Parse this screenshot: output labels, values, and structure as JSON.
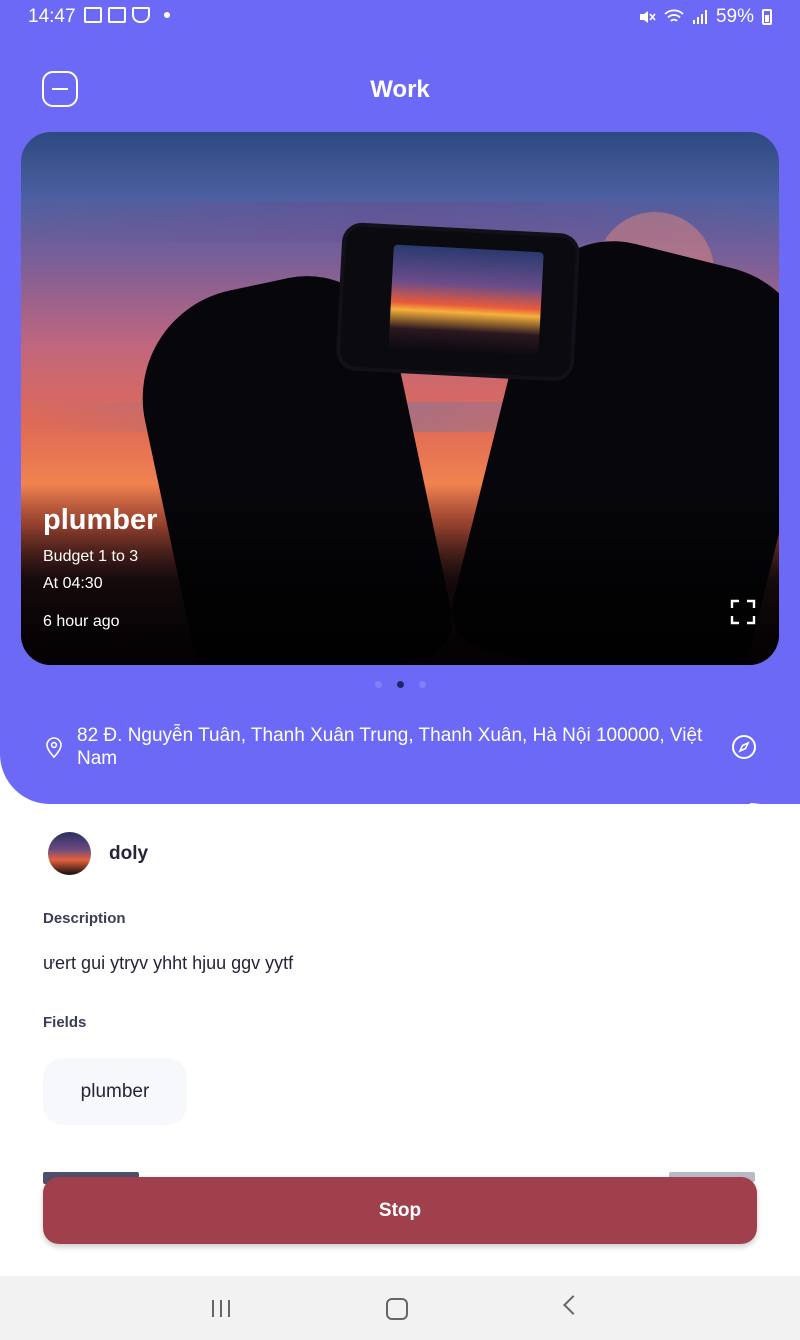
{
  "status_bar": {
    "time": "14:47",
    "battery": "59%"
  },
  "header": {
    "title": "Work"
  },
  "post": {
    "title": "plumber",
    "budget": "Budget 1 to 3",
    "time": "At 04:30",
    "posted_ago": "6 hour ago",
    "carousel": {
      "count": 3,
      "active_index": 1
    }
  },
  "location": {
    "address": "82 Đ. Nguyễn Tuân, Thanh Xuân Trung, Thanh Xuân, Hà Nội 100000, Việt Nam"
  },
  "user": {
    "name": "doly"
  },
  "description": {
    "label": "Description",
    "text": "ưert gui ytryv  yhht hjuu ggv yytf"
  },
  "fields": {
    "label": "Fields",
    "items": [
      "plumber"
    ]
  },
  "actions": {
    "stop_label": "Stop"
  },
  "colors": {
    "primary": "#6D69F7",
    "stop_button": "#A1404D",
    "chip_bg": "#F7F8FC"
  },
  "icons": [
    "menu-icon",
    "expand-icon",
    "location-pin-icon",
    "compass-icon",
    "nav-recents-icon",
    "nav-home-icon",
    "nav-back-icon"
  ]
}
